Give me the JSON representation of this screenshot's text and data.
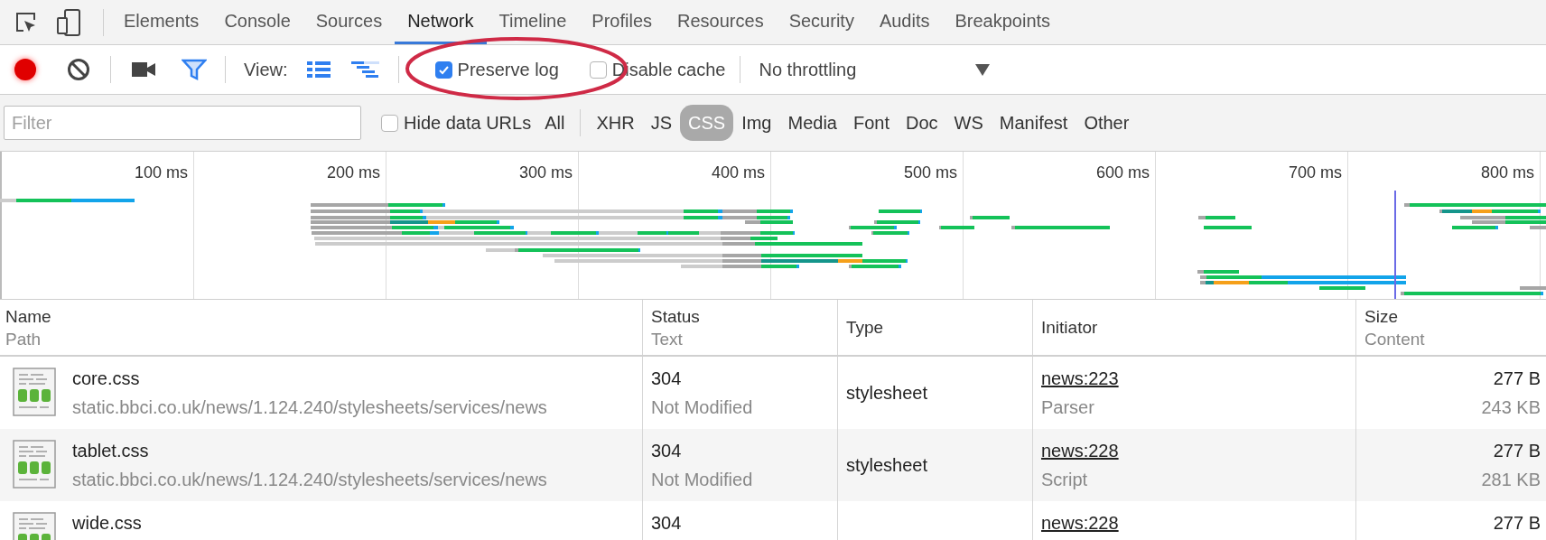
{
  "tabs": [
    {
      "label": "Elements",
      "selected": false
    },
    {
      "label": "Console",
      "selected": false
    },
    {
      "label": "Sources",
      "selected": false
    },
    {
      "label": "Network",
      "selected": true
    },
    {
      "label": "Timeline",
      "selected": false
    },
    {
      "label": "Profiles",
      "selected": false
    },
    {
      "label": "Resources",
      "selected": false
    },
    {
      "label": "Security",
      "selected": false
    },
    {
      "label": "Audits",
      "selected": false
    },
    {
      "label": "Breakpoints",
      "selected": false
    }
  ],
  "toolbar": {
    "recording": true,
    "filter_on": true,
    "view_label": "View:",
    "preserve_log": {
      "label": "Preserve log",
      "checked": true
    },
    "disable_cache": {
      "label": "Disable cache",
      "checked": false
    },
    "throttling": {
      "value": "No throttling"
    }
  },
  "filter_bar": {
    "filter": {
      "placeholder": "Filter"
    },
    "hide_data_urls": {
      "label": "Hide data URLs",
      "checked": false
    },
    "types": [
      {
        "label": "All",
        "selected": false
      },
      {
        "label": "XHR",
        "selected": false
      },
      {
        "label": "JS",
        "selected": false
      },
      {
        "label": "CSS",
        "selected": true
      },
      {
        "label": "Img",
        "selected": false
      },
      {
        "label": "Media",
        "selected": false
      },
      {
        "label": "Font",
        "selected": false
      },
      {
        "label": "Doc",
        "selected": false
      },
      {
        "label": "WS",
        "selected": false
      },
      {
        "label": "Manifest",
        "selected": false
      },
      {
        "label": "Other",
        "selected": false
      }
    ]
  },
  "timeline": {
    "ticks": [
      "100 ms",
      "200 ms",
      "300 ms",
      "400 ms",
      "500 ms",
      "600 ms",
      "700 ms",
      "800 ms"
    ]
  },
  "table": {
    "columns": [
      {
        "label": "Name",
        "sublabel": "Path"
      },
      {
        "label": "Status",
        "sublabel": "Text"
      },
      {
        "label": "Type"
      },
      {
        "label": "Initiator"
      },
      {
        "label": "Size",
        "sublabel": "Content"
      }
    ],
    "rows": [
      {
        "name": "core.css",
        "path": "static.bbci.co.uk/news/1.124.240/stylesheets/services/news",
        "status": "304",
        "status_text": "Not Modified",
        "type": "stylesheet",
        "initiator": "news:223",
        "initiator_type": "Parser",
        "size": "277 B",
        "content": "243 KB"
      },
      {
        "name": "tablet.css",
        "path": "static.bbci.co.uk/news/1.124.240/stylesheets/services/news",
        "status": "304",
        "status_text": "Not Modified",
        "type": "stylesheet",
        "initiator": "news:228",
        "initiator_type": "Script",
        "size": "277 B",
        "content": "281 KB"
      },
      {
        "name": "wide.css",
        "status": "304",
        "initiator": "news:228",
        "size": "277 B"
      }
    ]
  }
}
